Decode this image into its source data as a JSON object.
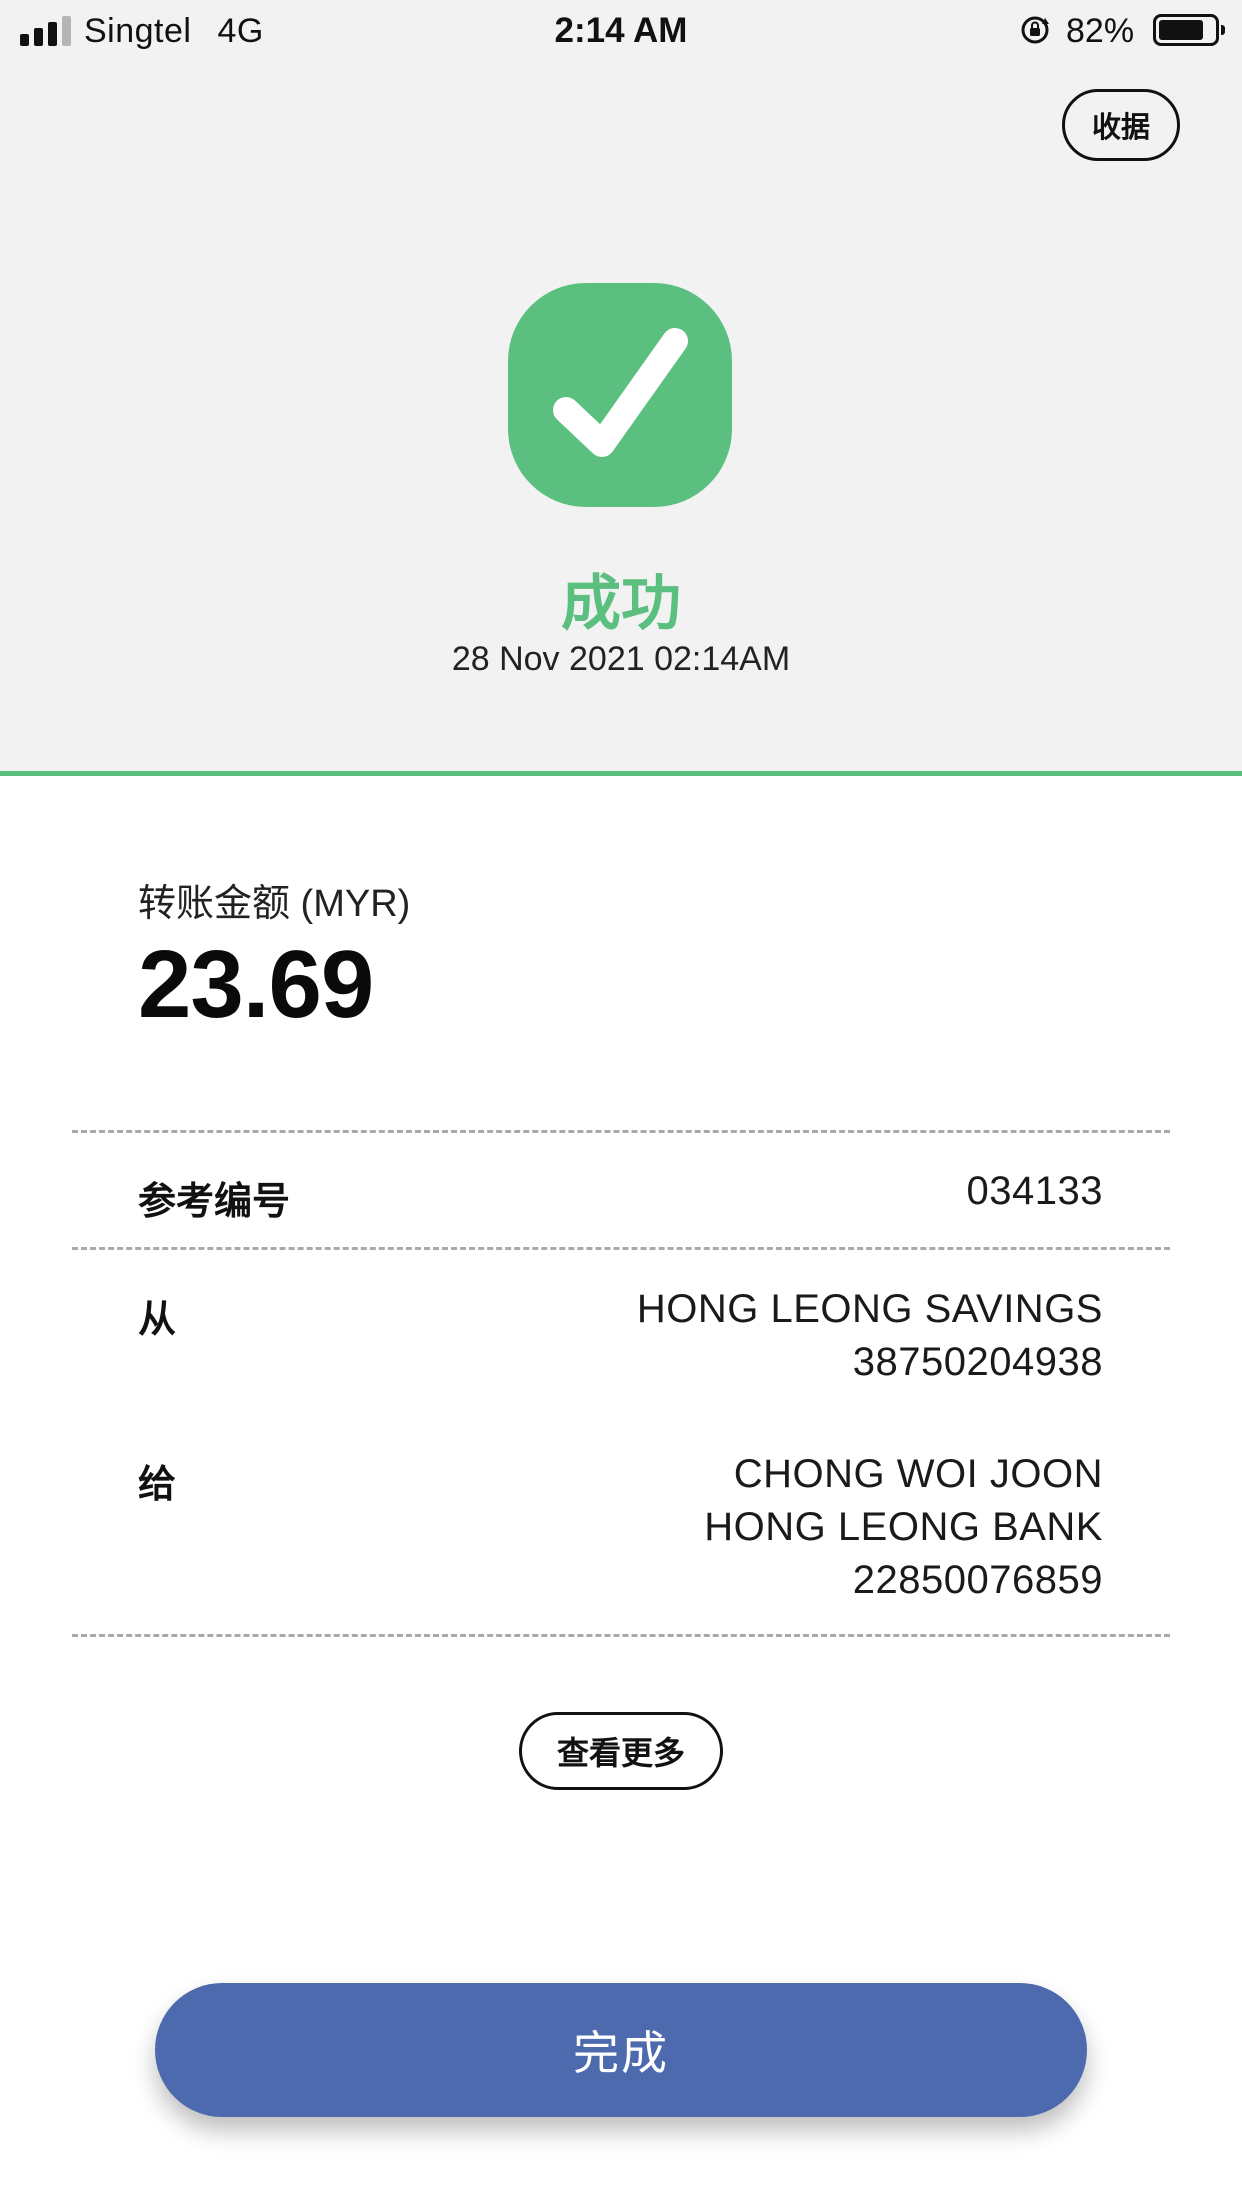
{
  "status_bar": {
    "carrier": "Singtel",
    "network": "4G",
    "time": "2:14 AM",
    "battery_percent": "82%",
    "battery_level": 0.82,
    "icons": [
      "signal-icon",
      "rotation-lock-icon",
      "battery-icon"
    ]
  },
  "header": {
    "receipt_label": "收据",
    "status_icon": "checkmark-icon",
    "status_text": "成功",
    "datetime": "28 Nov 2021 02:14AM"
  },
  "transfer": {
    "amount_label": "转账金额 (MYR)",
    "amount": "23.69"
  },
  "details": {
    "reference": {
      "label": "参考编号",
      "value": "034133"
    },
    "from": {
      "label": "从",
      "lines": [
        "HONG LEONG SAVINGS",
        "38750204938"
      ]
    },
    "to": {
      "label": "给",
      "lines": [
        "CHONG WOI JOON",
        "HONG LEONG BANK",
        "22850076859"
      ]
    }
  },
  "actions": {
    "view_more_label": "查看更多",
    "done_label": "完成"
  },
  "colors": {
    "success": "#5bbf7f",
    "primary_button": "#4d6aae",
    "header_bg": "#f2f2f2"
  }
}
